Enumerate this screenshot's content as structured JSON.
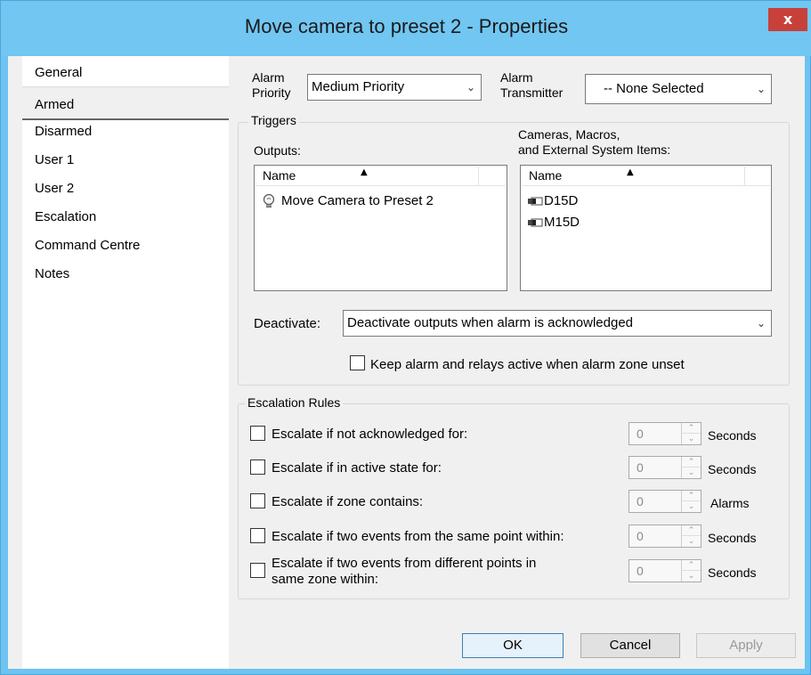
{
  "window": {
    "title": "Move camera to preset 2 - Properties",
    "close_label": "x"
  },
  "sidebar": {
    "items": [
      {
        "label": "General"
      },
      {
        "label": "Armed"
      },
      {
        "label": "Disarmed"
      },
      {
        "label": "User 1"
      },
      {
        "label": "User 2"
      },
      {
        "label": "Escalation"
      },
      {
        "label": "Command Centre"
      },
      {
        "label": "Notes"
      }
    ],
    "selected": "Armed"
  },
  "alarm": {
    "priority_label_1": "Alarm",
    "priority_label_2": "Priority",
    "priority_value": "Medium Priority",
    "transmitter_label_1": "Alarm",
    "transmitter_label_2": "Transmitter",
    "transmitter_value": "-- None Selected"
  },
  "triggers": {
    "title": "Triggers",
    "outputs_label": "Outputs:",
    "outputs_header": "Name",
    "outputs_items": [
      {
        "label": "Move Camera to Preset 2",
        "icon": "lightbulb-icon"
      }
    ],
    "cameras_label_1": "Cameras, Macros,",
    "cameras_label_2": "and External System Items:",
    "cameras_header": "Name",
    "cameras_items": [
      {
        "label": "D15D",
        "icon": "camera-icon"
      },
      {
        "label": "M15D",
        "icon": "camera-icon"
      }
    ],
    "deactivate_label": "Deactivate:",
    "deactivate_value": "Deactivate outputs when alarm is acknowledged",
    "keep_active_label": "Keep alarm and relays active when alarm zone unset"
  },
  "escalation": {
    "title": "Escalation Rules",
    "rules": [
      {
        "label": "Escalate if not acknowledged for:",
        "value": "0",
        "unit": "Seconds"
      },
      {
        "label": "Escalate if in active state for:",
        "value": "0",
        "unit": "Seconds"
      },
      {
        "label": "Escalate if zone contains:",
        "value": "0",
        "unit": "Alarms"
      },
      {
        "label": "Escalate if two events from the same point within:",
        "value": "0",
        "unit": "Seconds"
      },
      {
        "label_1": "Escalate if two events from different points in",
        "label_2": "same zone within:",
        "value": "0",
        "unit": "Seconds"
      }
    ]
  },
  "buttons": {
    "ok": "OK",
    "cancel": "Cancel",
    "apply": "Apply"
  },
  "colors": {
    "titlebar": "#71c6f2",
    "close": "#c7413a"
  }
}
